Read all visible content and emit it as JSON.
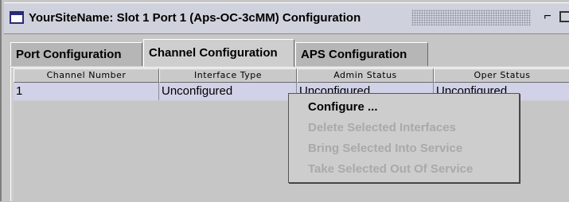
{
  "window": {
    "title": "YourSiteName: Slot 1 Port 1 (Aps-OC-3cMM) Configuration",
    "icons": {
      "app": "window-icon",
      "undock": "undock-icon",
      "maximize": "maximize-icon"
    },
    "undock_glyph": "⌐"
  },
  "tabs": [
    {
      "label": "Port Configuration",
      "active": false
    },
    {
      "label": "Channel Configuration",
      "active": true
    },
    {
      "label": "APS Configuration",
      "active": false
    }
  ],
  "table": {
    "columns": [
      "Channel Number",
      "Interface Type",
      "Admin Status",
      "Oper Status"
    ],
    "rows": [
      [
        "1",
        "Unconfigured",
        "Unconfigured",
        "Unconfigured"
      ]
    ]
  },
  "context_menu": {
    "items": [
      {
        "label": "Configure ...",
        "enabled": true
      },
      {
        "label": "Delete Selected Interfaces",
        "enabled": false
      },
      {
        "label": "Bring Selected Into Service",
        "enabled": false
      },
      {
        "label": "Take Selected Out Of Service",
        "enabled": false
      }
    ]
  },
  "colors": {
    "selected_row": "#d1d1e8",
    "disabled_text": "#a9a9a9",
    "titlebar": "#cfd1dc"
  }
}
